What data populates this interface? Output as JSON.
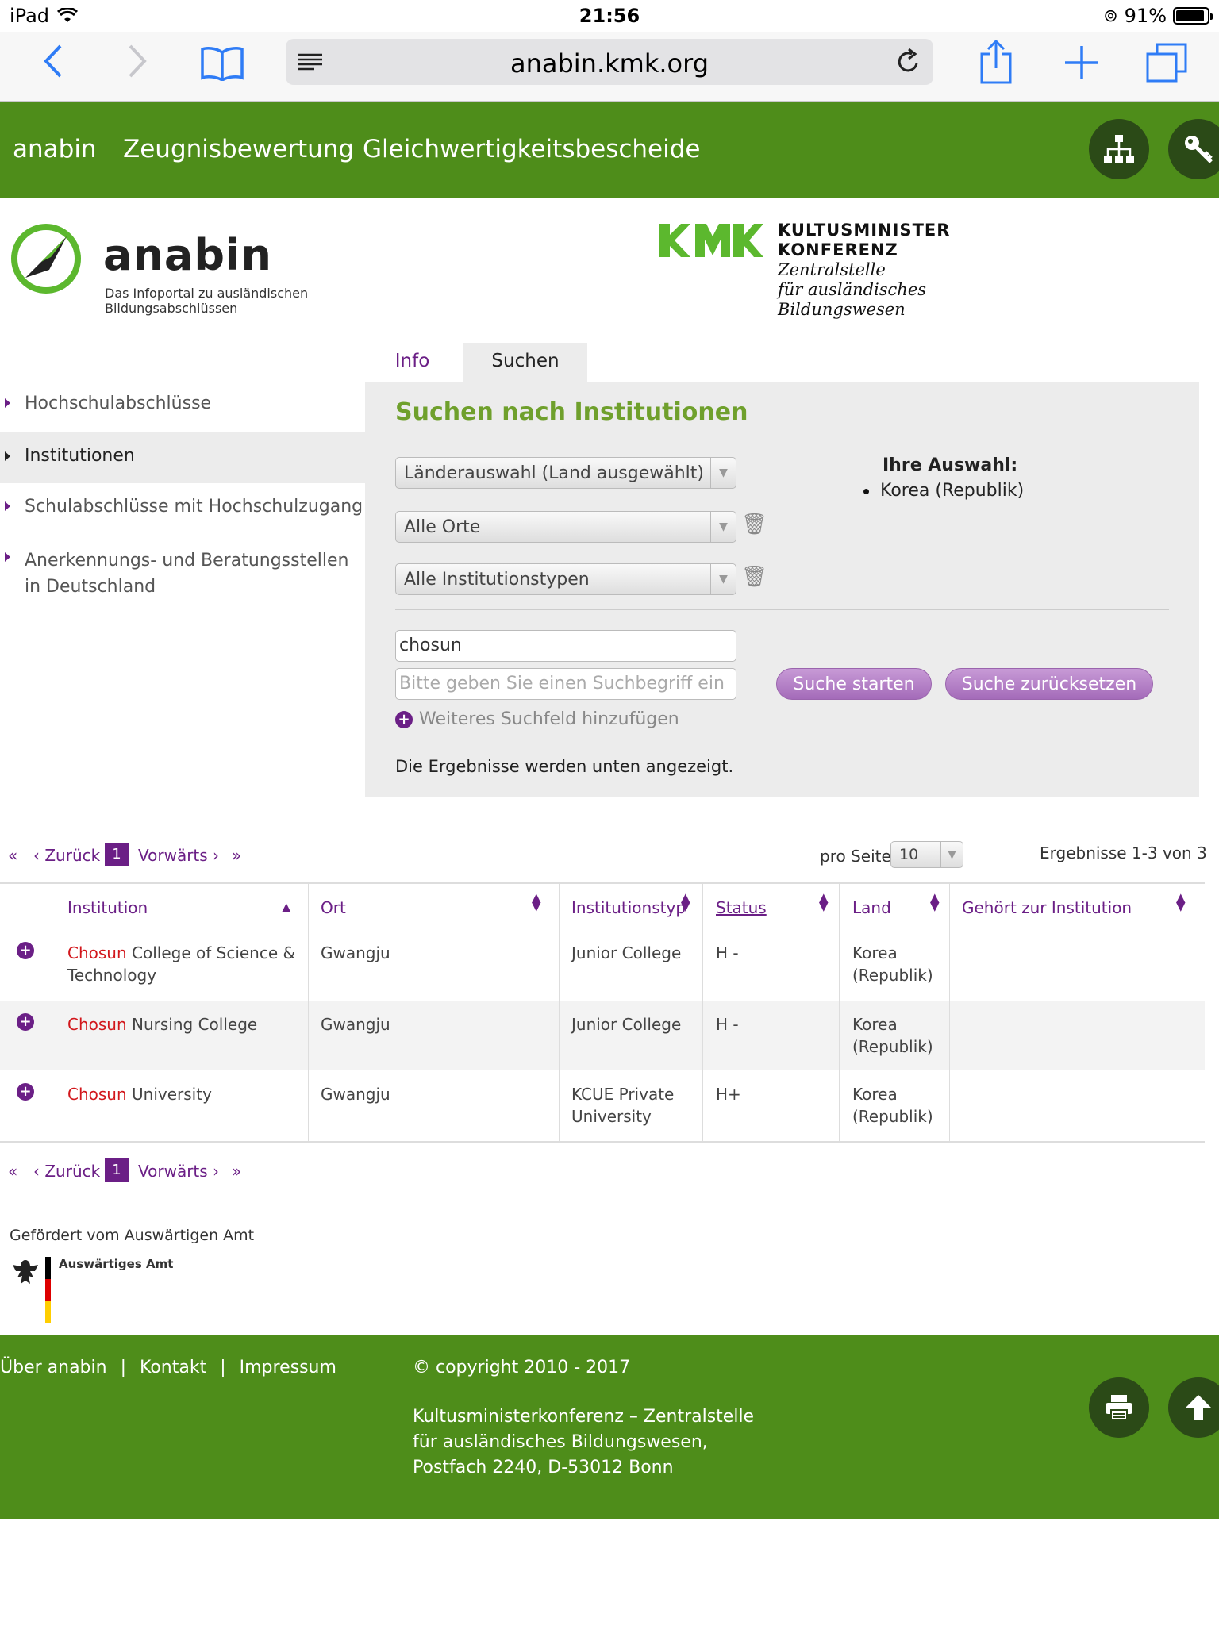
{
  "status_bar": {
    "device": "iPad",
    "time": "21:56",
    "battery": "91%",
    "battery_level": 0.91
  },
  "browser": {
    "url": "anabin.kmk.org"
  },
  "topnav": {
    "items": [
      "anabin",
      "Zeugnisbewertung",
      "Gleichwertigkeitsbescheide"
    ]
  },
  "brand": {
    "name": "anabin",
    "subtitle_line1": "Das Infoportal zu ausländischen",
    "subtitle_line2": "Bildungsabschlüssen"
  },
  "kmk": {
    "line1": "KULTUSMINISTER",
    "line2": "KONFERENZ",
    "line3": "Zentralstelle",
    "line4": "für ausländisches",
    "line5": "Bildungswesen"
  },
  "tabs": {
    "info": "Info",
    "suchen": "Suchen"
  },
  "sidebar": {
    "items": [
      {
        "label": "Hochschulabschlüsse"
      },
      {
        "label": "Institutionen"
      },
      {
        "label": "Schulabschlüsse mit Hochschulzugang"
      },
      {
        "label_line1": "Anerkennungs- und Beratungsstellen",
        "label_line2": "in Deutschland"
      }
    ]
  },
  "search": {
    "title": "Suchen nach Institutionen",
    "country_select": "Länderauswahl (Land ausgewählt)",
    "place_select": "Alle Orte",
    "type_select": "Alle Institutionstypen",
    "selection_label": "Ihre Auswahl:",
    "selection_item": "Korea (Republik)",
    "term_value": "chosun",
    "term_placeholder": "Bitte geben Sie einen Suchbegriff ein",
    "start_button": "Suche starten",
    "reset_button": "Suche zurücksetzen",
    "add_field": "Weiteres Suchfeld hinzufügen",
    "results_note": "Die Ergebnisse werden unten angezeigt."
  },
  "pagination": {
    "first": "«",
    "prev": "‹ Zurück",
    "current": "1",
    "next": "Vorwärts ›",
    "last": "»",
    "per_page_label": "pro Seite",
    "per_page_value": "10",
    "results_count": "Ergebnisse 1-3 von 3"
  },
  "table": {
    "headers": {
      "institution": "Institution",
      "ort": "Ort",
      "typ": "Institutionstyp",
      "status": "Status",
      "land": "Land",
      "gehoert": "Gehört zur Institution"
    },
    "rows": [
      {
        "highlight": "Chosun",
        "name_rest": " College of Science &",
        "name_line2": "Technology",
        "ort": "Gwangju",
        "typ_line1": "Junior College",
        "typ_line2": "",
        "status": "H -",
        "land_line1": "Korea",
        "land_line2": "(Republik)"
      },
      {
        "highlight": "Chosun",
        "name_rest": " Nursing College",
        "name_line2": "",
        "ort": "Gwangju",
        "typ_line1": "Junior College",
        "typ_line2": "",
        "status": "H -",
        "land_line1": "Korea",
        "land_line2": "(Republik)"
      },
      {
        "highlight": "Chosun",
        "name_rest": " University",
        "name_line2": "",
        "ort": "Gwangju",
        "typ_line1": "KCUE Private",
        "typ_line2": "University",
        "status": "H+",
        "land_line1": "Korea",
        "land_line2": "(Republik)"
      }
    ]
  },
  "sponsor": {
    "label": "Gefördert vom Auswärtigen Amt",
    "logo_text": "Auswärtiges Amt"
  },
  "footer": {
    "links": [
      "Über anabin",
      "Kontakt",
      "Impressum"
    ],
    "separator": "|",
    "copyright": "© copyright 2010 - 2017",
    "address_line1": "Kultusministerkonferenz – Zentralstelle",
    "address_line2": "für ausländisches Bildungswesen,",
    "address_line3": "Postfach 2240, D-53012 Bonn"
  },
  "colors": {
    "green": "#4e8d1a",
    "purple": "#6b1f86",
    "title_green": "#6fa02c",
    "highlight_red": "#d2171c"
  }
}
